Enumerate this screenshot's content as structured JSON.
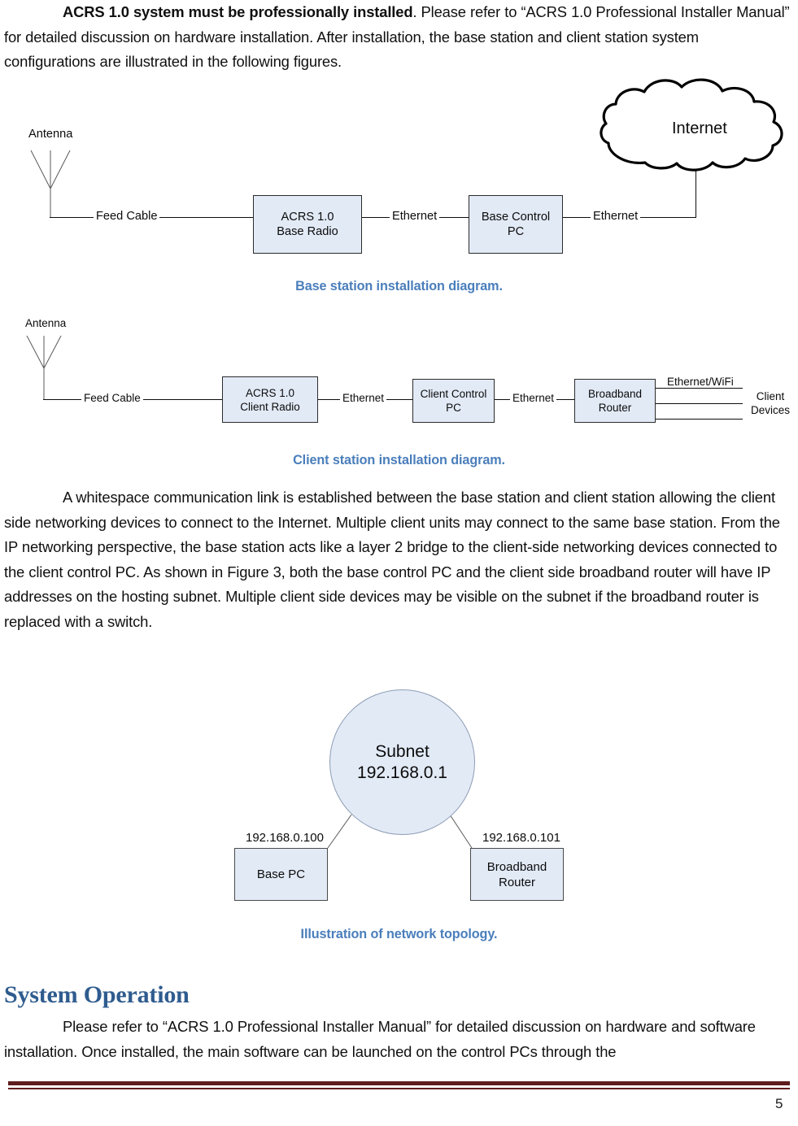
{
  "document": {
    "page_number": "5",
    "colors": {
      "caption_blue": "#4a7ebb",
      "heading_blue": "#2f5c8f",
      "box_fill": "#e2eaf6",
      "footer_rule": "#5f1d1d"
    }
  },
  "intro_paragraph": {
    "bold_lead": "ACRS 1.0 system must be professionally installed",
    "rest": ". Please refer to “ACRS 1.0 Professional Installer Manual” for detailed discussion on hardware installation. After installation, the base station and client station system configurations are illustrated in the following figures."
  },
  "figure_base_station": {
    "caption": "Base station installation diagram.",
    "nodes": {
      "antenna_label": "Antenna",
      "feed_cable_label": "Feed Cable",
      "acrs_base_radio": "ACRS 1.0\nBase Radio",
      "acrs_base_radio_line1": "ACRS 1.0",
      "acrs_base_radio_line2": "Base Radio",
      "ethernet_left_label": "Ethernet",
      "base_control_pc_line1": "Base Control",
      "base_control_pc_line2": "PC",
      "ethernet_right_label": "Ethernet",
      "internet_cloud": "Internet"
    }
  },
  "figure_client_station": {
    "caption": "Client station installation diagram.",
    "nodes": {
      "antenna_label": "Antenna",
      "feed_cable_label": "Feed Cable",
      "acrs_client_radio_line1": "ACRS 1.0",
      "acrs_client_radio_line2": "Client Radio",
      "ethernet_1_label": "Ethernet",
      "client_control_pc_line1": "Client Control",
      "client_control_pc_line2": "PC",
      "ethernet_2_label": "Ethernet",
      "broadband_router_line1": "Broadband",
      "broadband_router_line2": "Router",
      "ethernet_wifi_label": "Ethernet/WiFi",
      "client_devices_line1": "Client",
      "client_devices_line2": "Devices"
    }
  },
  "body_paragraph": {
    "text": "A whitespace communication link is established between the base station and client station allowing the client side networking devices to connect to the Internet. Multiple client units may connect to the same base station. From the IP networking perspective, the base station acts like a layer 2 bridge to the client-side networking devices connected to the client control PC. As shown in Figure 3, both the base control PC and the client side broadband router will have IP addresses on the hosting subnet. Multiple client side devices may be visible on the subnet if the broadband router is replaced with a switch."
  },
  "figure_topology": {
    "caption": "Illustration of network topology.",
    "nodes": {
      "subnet_line1": "Subnet",
      "subnet_line2": "192.168.0.1",
      "base_pc_ip": "192.168.0.100",
      "base_pc_label": "Base PC",
      "router_ip": "192.168.0.101",
      "router_line1": "Broadband",
      "router_line2": "Router"
    }
  },
  "section_system_operation": {
    "heading": "System Operation",
    "paragraph": "Please refer to “ACRS 1.0 Professional Installer Manual” for detailed discussion on hardware and software installation. Once installed, the main software can be launched on the control PCs through the"
  }
}
